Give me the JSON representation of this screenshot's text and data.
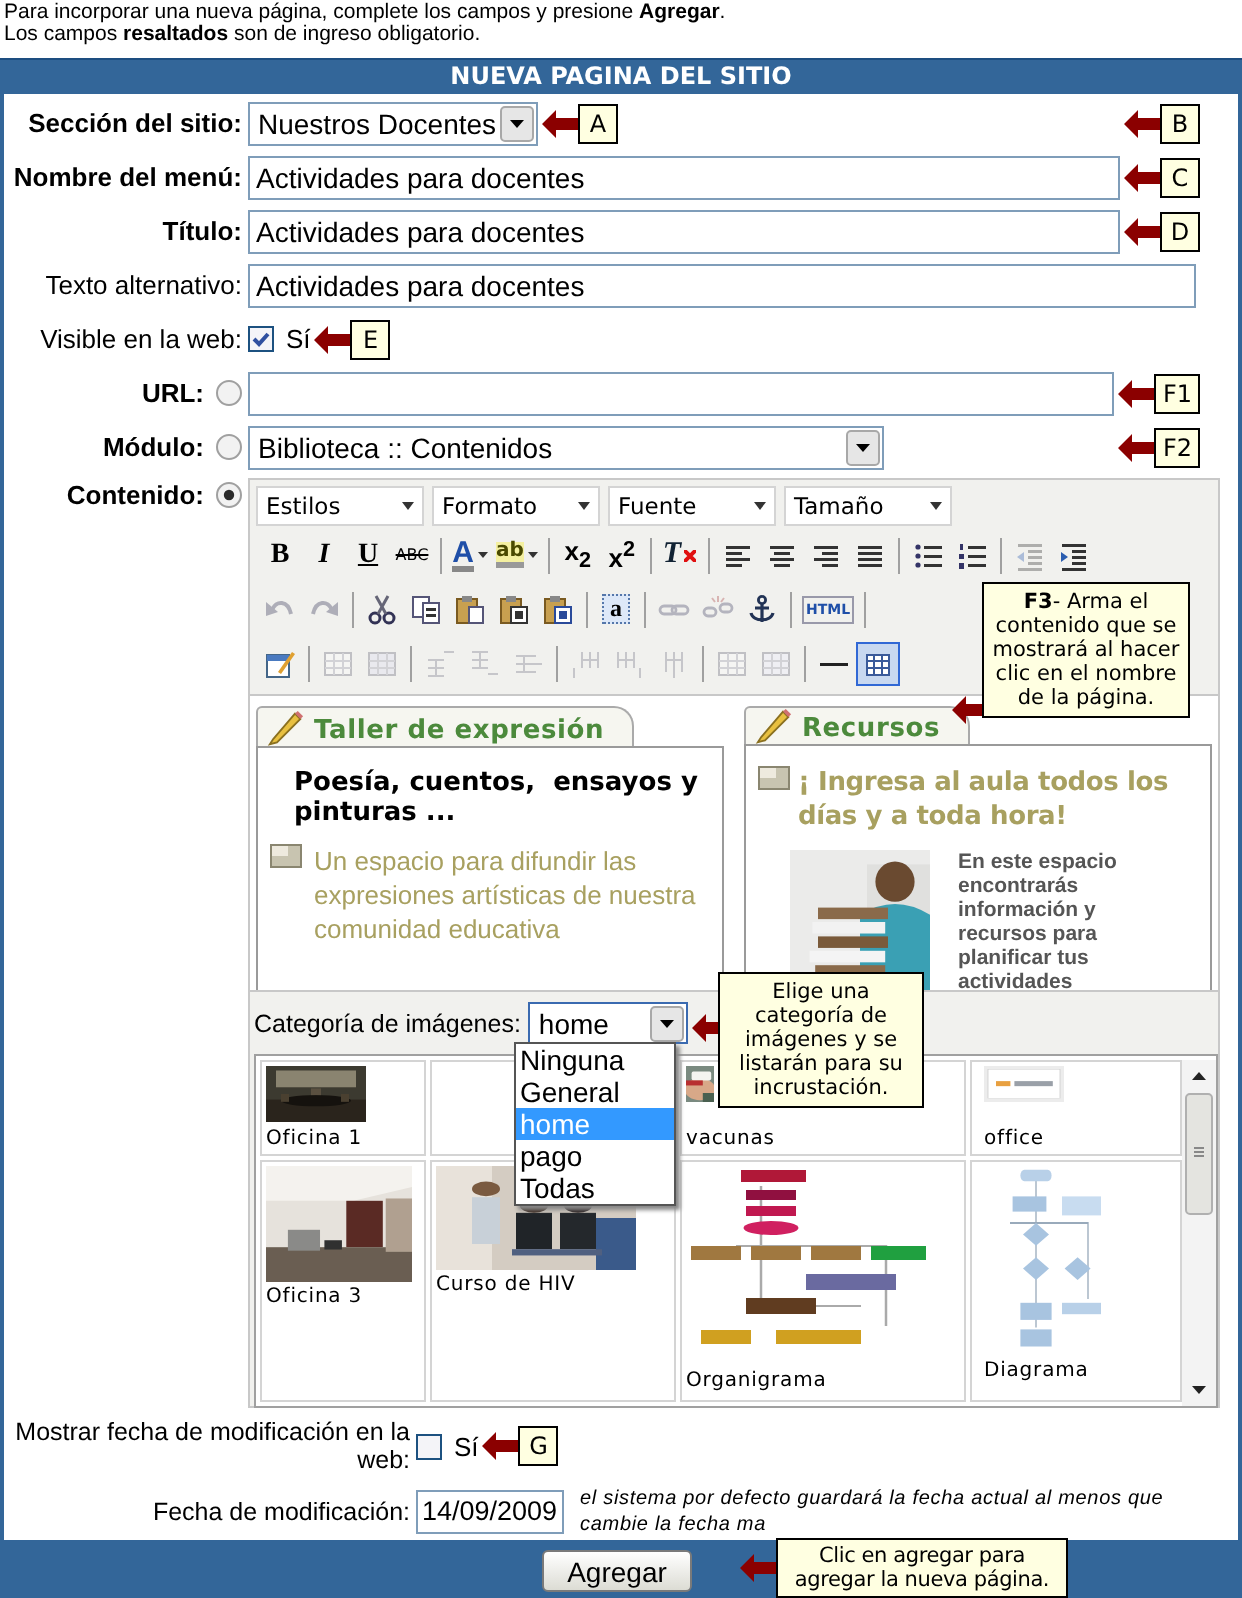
{
  "intro": [
    "Para incorporar una nueva página, complete los campos y presione **Agregar**.",
    "Los campos **resaltados** son de ingreso obligatorio."
  ],
  "panel": {
    "title": "NUEVA PAGINA DEL SITIO"
  },
  "fields": [
    {
      "kind": "select",
      "label": "Sección del sitio:",
      "required": true,
      "value": "Nuestros Docentes",
      "marker": "A",
      "end_marker": "B"
    },
    {
      "kind": "text",
      "label": "Nombre del menú:",
      "required": true,
      "value": "Actividades para docentes",
      "marker": "C"
    },
    {
      "kind": "text",
      "label": "Título:",
      "required": true,
      "value": "Actividades para docentes",
      "marker": "D"
    },
    {
      "kind": "text",
      "label": "Texto alternativo:",
      "required": false,
      "value": "Actividades para docentes"
    },
    {
      "kind": "checkbox",
      "label": "Visible en la web:",
      "required": false,
      "checked": true,
      "option_label": "Sí",
      "marker": "E"
    },
    {
      "kind": "text",
      "label": "URL:",
      "required": true,
      "radio": {
        "selected": false
      },
      "marker": "F1"
    },
    {
      "kind": "select",
      "label": "Módulo:",
      "required": true,
      "radio": {
        "selected": false
      },
      "value": "Biblioteca :: Contenidos",
      "end_marker": "F2"
    },
    {
      "kind": "editor",
      "label": "Contenido:",
      "required": true,
      "radio": {
        "selected": true
      }
    }
  ],
  "editor": {
    "combos": [
      "Estilos",
      "Formato",
      "Fuente",
      "Tamaño"
    ],
    "toolbar": [
      [
        {
          "kind": "bold",
          "text": "B",
          "disabled": false,
          "on": false
        },
        {
          "kind": "italic",
          "text": "I",
          "disabled": false,
          "on": false
        },
        {
          "kind": "underline",
          "text": "U",
          "disabled": false,
          "on": false
        },
        {
          "kind": "strike",
          "text": "ABC",
          "disabled": false,
          "on": false
        },
        {
          "kind": "sep"
        },
        {
          "kind": "fontcolor",
          "text": "A",
          "disabled": false,
          "on": false
        },
        {
          "kind": "highlight",
          "text": "ab",
          "disabled": false,
          "on": false
        },
        {
          "kind": "sep"
        },
        {
          "kind": "sub",
          "text": "x$_{2}$",
          "disabled": false,
          "on": false
        },
        {
          "kind": "sup",
          "text": "x$^{2}$",
          "disabled": false,
          "on": false
        },
        {
          "kind": "sep"
        },
        {
          "kind": "clearformat",
          "text": "T",
          "disabled": false,
          "on": false
        },
        {
          "kind": "sep"
        },
        {
          "kind": "alignleft",
          "disabled": false,
          "on": false
        },
        {
          "kind": "aligncenter",
          "disabled": false,
          "on": false
        },
        {
          "kind": "alignright",
          "disabled": false,
          "on": false
        },
        {
          "kind": "justify",
          "disabled": false,
          "on": false
        },
        {
          "kind": "sep"
        },
        {
          "kind": "bullets",
          "disabled": false,
          "on": false
        },
        {
          "kind": "numbers",
          "disabled": false,
          "on": false
        },
        {
          "kind": "sep"
        },
        {
          "kind": "outdent",
          "disabled": true,
          "on": false
        },
        {
          "kind": "indent",
          "disabled": false,
          "on": false
        }
      ],
      [
        {
          "kind": "undo",
          "disabled": true,
          "on": false
        },
        {
          "kind": "redo",
          "disabled": true,
          "on": false
        },
        {
          "kind": "sep"
        },
        {
          "kind": "cut",
          "disabled": false,
          "on": false
        },
        {
          "kind": "copy",
          "disabled": false,
          "on": false
        },
        {
          "kind": "paste",
          "disabled": false,
          "on": false
        },
        {
          "kind": "pastetext",
          "disabled": false,
          "on": false
        },
        {
          "kind": "pasteword",
          "disabled": false,
          "on": false
        },
        {
          "kind": "sep"
        },
        {
          "kind": "selectall",
          "text": "a",
          "disabled": false,
          "on": false
        },
        {
          "kind": "sep"
        },
        {
          "kind": "link",
          "disabled": true,
          "on": false
        },
        {
          "kind": "unlink",
          "disabled": true,
          "on": false
        },
        {
          "kind": "anchor",
          "disabled": false,
          "on": false
        },
        {
          "kind": "sep"
        },
        {
          "kind": "source",
          "text": "HTML",
          "disabled": false,
          "on": false
        },
        {
          "kind": "sep"
        }
      ],
      [
        {
          "kind": "form",
          "disabled": false,
          "on": false
        },
        {
          "kind": "sep"
        },
        {
          "kind": "cellprops",
          "disabled": true,
          "on": false
        },
        {
          "kind": "rowprops",
          "disabled": true,
          "on": false
        },
        {
          "kind": "sep"
        },
        {
          "kind": "insrowbefore",
          "disabled": true,
          "on": false
        },
        {
          "kind": "insrowafter",
          "disabled": true,
          "on": false
        },
        {
          "kind": "delrow",
          "disabled": true,
          "on": false
        },
        {
          "kind": "sep"
        },
        {
          "kind": "inscolbefore",
          "disabled": true,
          "on": false
        },
        {
          "kind": "inscolafter",
          "disabled": true,
          "on": false
        },
        {
          "kind": "delcol",
          "disabled": true,
          "on": false
        },
        {
          "kind": "sep"
        },
        {
          "kind": "merge",
          "disabled": true,
          "on": false
        },
        {
          "kind": "split",
          "disabled": true,
          "on": false
        },
        {
          "kind": "sep"
        },
        {
          "kind": "hr",
          "disabled": false,
          "on": false
        },
        {
          "kind": "table",
          "disabled": false,
          "on": true
        }
      ]
    ],
    "tooltip": "**F3**- Arma el contenido que se mostrará al hacer clic en el nombre de la página.",
    "columns": [
      {
        "kind": "article",
        "tab": "Taller de expresión",
        "heading": "Poesía, cuentos,  ensayos y pinturas ...",
        "text": "Un espacio para difundir las expresiones artísticas de nuestra comunidad educativa"
      },
      {
        "kind": "feature",
        "tab": "Recursos",
        "heading": "¡ Ingresa al aula todos los días y a toda hora!",
        "text": "En este espacio encontrarás información y recursos para planificar tus actividades"
      }
    ],
    "image_category": {
      "label": "Categoría de imágenes:",
      "value": "home",
      "expanded": true,
      "options": [
        {
          "label": "Ninguna",
          "selected": false
        },
        {
          "label": "General",
          "selected": false
        },
        {
          "label": "home",
          "selected": true
        },
        {
          "label": "pago",
          "selected": false
        },
        {
          "label": "Todas",
          "selected": false
        }
      ],
      "tooltip": "Elige una categoría de imágenes y se listarán para su incrustación."
    },
    "gallery": [
      {
        "kind": "picture",
        "caption": "Oficina 1"
      },
      {
        "kind": "covered"
      },
      {
        "kind": "picture",
        "caption": "vacunas"
      },
      {
        "kind": "picture",
        "caption": "office"
      },
      {
        "kind": "picture",
        "caption": "Oficina 3"
      },
      {
        "kind": "picture",
        "caption": "Curso de HIV"
      },
      {
        "kind": "picture",
        "caption": "Organigrama"
      },
      {
        "kind": "picture",
        "caption": "Diagrama"
      }
    ]
  },
  "extra_fields": [
    {
      "kind": "checkbox",
      "label": "Mostrar fecha de modificación en la web:",
      "required": false,
      "checked": false,
      "option_label": "Sí",
      "marker": "G"
    },
    {
      "kind": "date",
      "label": "Fecha de modificación:",
      "required": false,
      "value": "14/09/2009",
      "note": "el sistema por defecto guardará la fecha actual al menos que cambie la fecha ma"
    }
  ],
  "submit": {
    "label": "Agregar",
    "tooltip": "Clic en agregar para agregar la nueva página."
  }
}
